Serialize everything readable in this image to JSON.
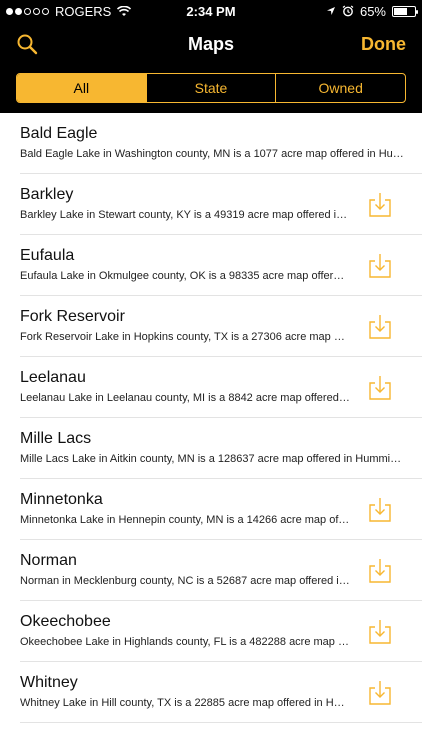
{
  "status": {
    "carrier": "ROGERS",
    "time": "2:34 PM",
    "battery": "65%",
    "battery_level": 0.65
  },
  "nav": {
    "title": "Maps",
    "done_label": "Done"
  },
  "segments": [
    {
      "label": "All",
      "selected": true
    },
    {
      "label": "State",
      "selected": false
    },
    {
      "label": "Owned",
      "selected": false
    }
  ],
  "maps": [
    {
      "name": "Bald Eagle",
      "desc": "Bald Eagle Lake in Washington county, MN is a 1077 acre map offered in Hum...",
      "download": false
    },
    {
      "name": "Barkley",
      "desc": "Barkley Lake in Stewart county, KY is a 49319 acre map offered in Humminbird...",
      "download": true
    },
    {
      "name": "Eufaula",
      "desc": "Eufaula Lake in Okmulgee county, OK is a 98335 acre map offered in Humminbird...",
      "download": true
    },
    {
      "name": "Fork Reservoir",
      "desc": "Fork Reservoir Lake in Hopkins county, TX is a 27306 acre map offered in...",
      "download": true
    },
    {
      "name": "Leelanau",
      "desc": "Leelanau Lake in Leelanau county, MI is a 8842 acre map offered in Humminbird...",
      "download": true
    },
    {
      "name": "Mille Lacs",
      "desc": "Mille Lacs Lake in Aitkin county, MN is a 128637 acre map offered in Humminbird...",
      "download": false
    },
    {
      "name": "Minnetonka",
      "desc": "Minnetonka Lake in Hennepin county, MN is a 14266 acre map offered in...",
      "download": true
    },
    {
      "name": "Norman",
      "desc": "Norman in Mecklenburg county, NC is a 52687 acre map offered in Humminbird...",
      "download": true
    },
    {
      "name": "Okeechobee",
      "desc": "Okeechobee Lake in Highlands county, FL is a 482288 acre map offered in...",
      "download": true
    },
    {
      "name": "Whitney",
      "desc": "Whitney Lake in Hill county, TX is a 22885 acre map offered in Humminbird...",
      "download": true
    }
  ],
  "colors": {
    "accent": "#f7b731",
    "bar_bg": "#000000",
    "divider": "#e3e3e3"
  },
  "icons": {
    "search": "search-icon",
    "download": "download-icon",
    "wifi": "wifi-icon",
    "location": "location-arrow-icon",
    "alarm": "alarm-icon",
    "battery": "battery-icon"
  }
}
